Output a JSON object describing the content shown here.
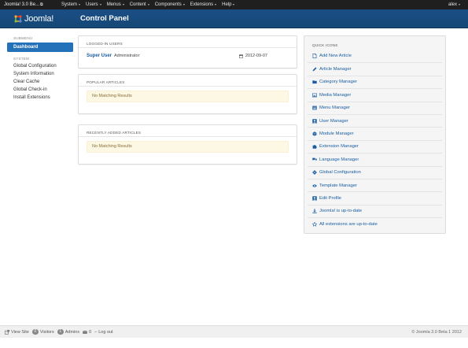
{
  "topbar": {
    "site_name": "Joomla! 3.0 Be...",
    "menus": [
      "System",
      "Users",
      "Menus",
      "Content",
      "Components",
      "Extensions",
      "Help"
    ],
    "user": "alex"
  },
  "header": {
    "logo_text": "Joomla!",
    "page_title": "Control Panel"
  },
  "sidebar": {
    "submenu_heading": "SUBMENU",
    "active_item": "Dashboard",
    "system_heading": "SYSTEM",
    "items": [
      "Global Configuration",
      "System Information",
      "Clear Cache",
      "Global Check-in",
      "Install Extensions"
    ]
  },
  "logged_in": {
    "heading": "LOGGED-IN USERS",
    "user_name": "Super User",
    "user_role": "Administrator",
    "date": "2012-09-07"
  },
  "popular": {
    "heading": "POPULAR ARTICLES",
    "message": "No Matching Results"
  },
  "recent": {
    "heading": "RECENTLY ADDED ARTICLES",
    "message": "No Matching Results"
  },
  "quick_icons": {
    "heading": "QUICK ICONS",
    "items": [
      {
        "label": "Add New Article",
        "icon": "new-article-icon"
      },
      {
        "label": "Article Manager",
        "icon": "pencil-icon"
      },
      {
        "label": "Category Manager",
        "icon": "folder-icon"
      },
      {
        "label": "Media Manager",
        "icon": "image-icon"
      },
      {
        "label": "Menu Manager",
        "icon": "menu-list-icon"
      },
      {
        "label": "User Manager",
        "icon": "user-icon"
      },
      {
        "label": "Module Manager",
        "icon": "cube-icon"
      },
      {
        "label": "Extension Manager",
        "icon": "puzzle-icon"
      },
      {
        "label": "Language Manager",
        "icon": "comments-icon"
      },
      {
        "label": "Global Configuration",
        "icon": "cog-icon"
      },
      {
        "label": "Template Manager",
        "icon": "eye-icon"
      },
      {
        "label": "Edit Profile",
        "icon": "profile-icon"
      },
      {
        "label": "Joomla! is up-to-date",
        "icon": "download-icon"
      },
      {
        "label": "All extensions are up-to-date",
        "icon": "star-icon"
      }
    ]
  },
  "footer": {
    "view_site": "View Site",
    "visitors_count": "0",
    "visitors_label": "Visitors",
    "admins_count": "1",
    "admins_label": "Admins",
    "messages_count": "0",
    "logout": "Log out",
    "copyright": "© Joomla 3.0 Beta 1 2012"
  },
  "colors": {
    "header_blue": "#1b4e84",
    "active_blue": "#2371b8",
    "link_blue": "#1a5ea1",
    "alert_bg": "#fcf8e3"
  }
}
